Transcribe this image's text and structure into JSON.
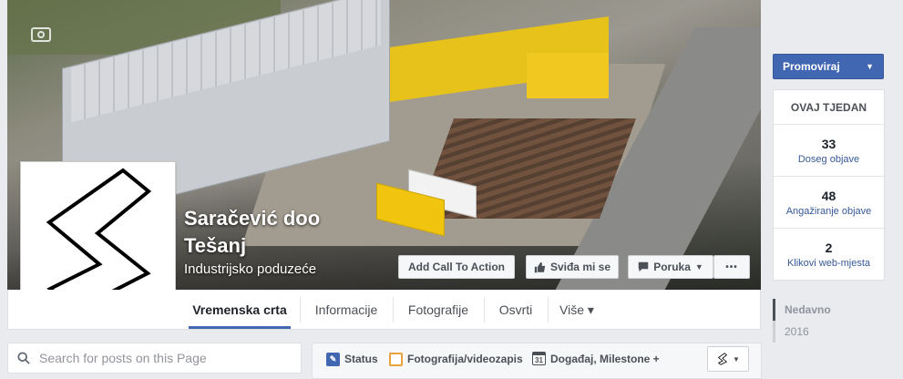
{
  "page": {
    "name_line1": "Saračević doo",
    "name_line2": "Tešanj",
    "category": "Industrijsko poduzeće"
  },
  "cover_buttons": {
    "call_to_action": "Add Call To Action",
    "like": "Sviđa mi se",
    "message": "Poruka",
    "more": "•••"
  },
  "tabs": [
    {
      "label": "Vremenska crta",
      "active": true
    },
    {
      "label": "Informacije"
    },
    {
      "label": "Fotografije"
    },
    {
      "label": "Osvrti"
    },
    {
      "label": "Više ▾"
    }
  ],
  "search": {
    "placeholder": "Search for posts on this Page"
  },
  "composer": {
    "status": "Status",
    "photo_video": "Fotografija/videozapis",
    "event": "Događaj, Milestone +",
    "calendar_day": "31"
  },
  "sidebar": {
    "promote_label": "Promoviraj",
    "week_title": "OVAJ TJEDAN",
    "stats": [
      {
        "value": "33",
        "label": "Doseg objave"
      },
      {
        "value": "48",
        "label": "Angažiranje objave"
      },
      {
        "value": "2",
        "label": "Klikovi web-mjesta"
      }
    ],
    "timeline_nav": [
      {
        "label": "Nedavno"
      },
      {
        "label": "2016"
      }
    ]
  },
  "colors": {
    "brand_blue": "#4267b2",
    "link_blue": "#365899",
    "background": "#e9ebee"
  }
}
